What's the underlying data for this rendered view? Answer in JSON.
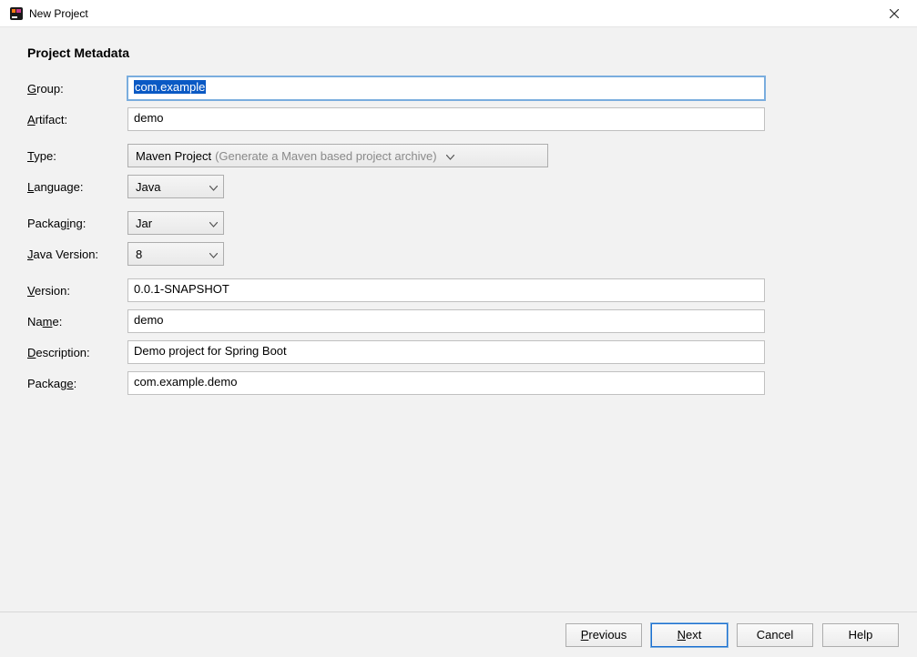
{
  "window": {
    "title": "New Project"
  },
  "heading": "Project Metadata",
  "labels": {
    "group": {
      "pre": "",
      "mn": "G",
      "post": "roup:"
    },
    "artifact": {
      "pre": "",
      "mn": "A",
      "post": "rtifact:"
    },
    "type": {
      "pre": "",
      "mn": "T",
      "post": "ype:"
    },
    "language": {
      "pre": "",
      "mn": "L",
      "post": "anguage:"
    },
    "packaging": {
      "pre": "Packag",
      "mn": "i",
      "post": "ng:"
    },
    "java_version": {
      "pre": "",
      "mn": "J",
      "post": "ava Version:"
    },
    "version": {
      "pre": "",
      "mn": "V",
      "post": "ersion:"
    },
    "name": {
      "pre": "Na",
      "mn": "m",
      "post": "e:"
    },
    "description": {
      "pre": "",
      "mn": "D",
      "post": "escription:"
    },
    "package": {
      "pre": "Packag",
      "mn": "e",
      "post": ":"
    }
  },
  "fields": {
    "group": "com.example",
    "artifact": "demo",
    "type_value": "Maven Project",
    "type_hint": "(Generate a Maven based project archive)",
    "language": "Java",
    "packaging": "Jar",
    "java_version": "8",
    "version": "0.0.1-SNAPSHOT",
    "name": "demo",
    "description": "Demo project for Spring Boot",
    "package": "com.example.demo"
  },
  "buttons": {
    "previous": {
      "pre": "",
      "mn": "P",
      "post": "revious"
    },
    "next": {
      "pre": "",
      "mn": "N",
      "post": "ext"
    },
    "cancel": "Cancel",
    "help": "Help"
  }
}
